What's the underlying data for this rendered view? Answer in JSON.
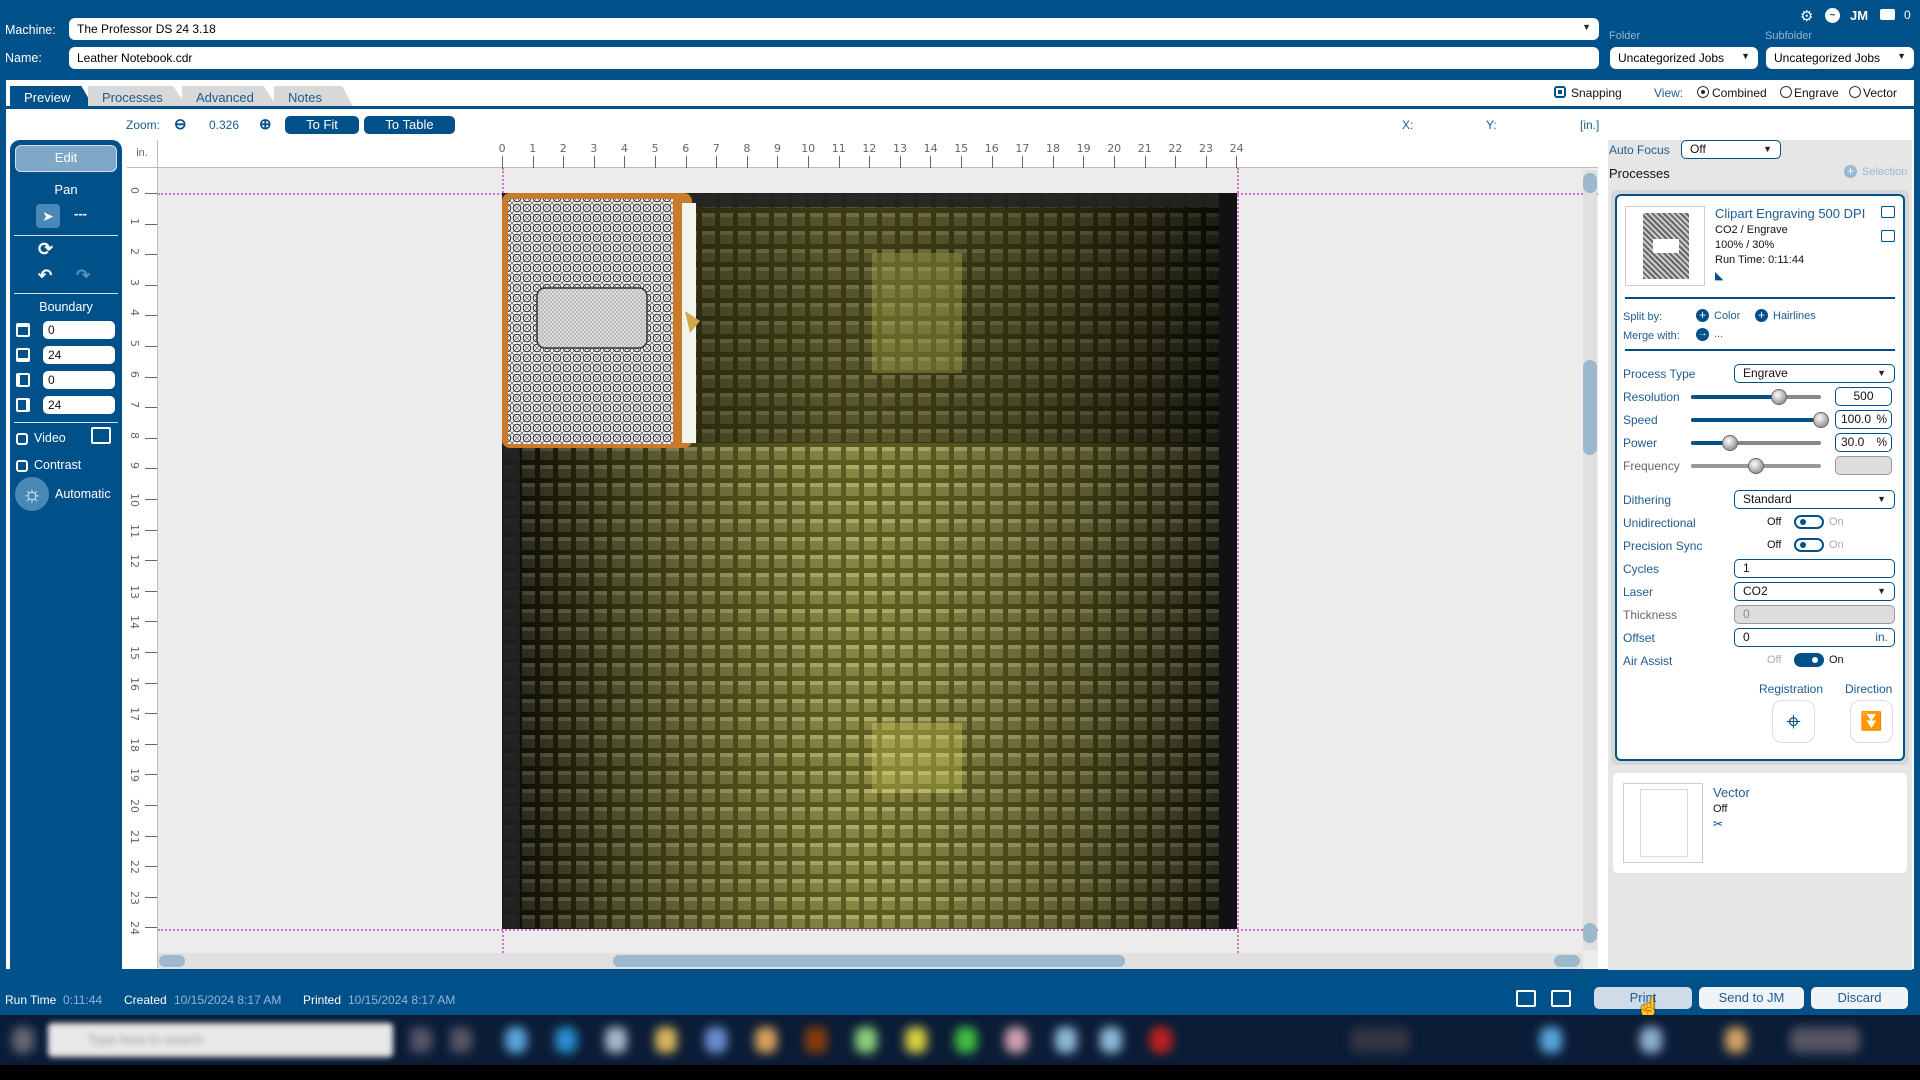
{
  "header": {
    "machine_label": "Machine:",
    "machine_value": "The Professor DS 24 3.18",
    "name_label": "Name:",
    "name_value": "Leather Notebook.cdr",
    "folder_label": "Folder",
    "folder_value": "Uncategorized Jobs",
    "subfolder_label": "Subfolder",
    "subfolder_value": "Uncategorized Jobs",
    "top_icons": [
      "gear-icon",
      "activity-icon",
      "jm-icon",
      "printer-icon"
    ],
    "jm_text": "JM",
    "printer_count": "0"
  },
  "tabs": [
    {
      "label": "Preview",
      "active": true
    },
    {
      "label": "Processes",
      "active": false
    },
    {
      "label": "Advanced",
      "active": false
    },
    {
      "label": "Notes",
      "active": false
    }
  ],
  "view_options": {
    "snapping_label": "Snapping",
    "snapping_checked": true,
    "view_label": "View:",
    "modes": [
      {
        "label": "Combined",
        "selected": true
      },
      {
        "label": "Engrave",
        "selected": false
      },
      {
        "label": "Vector",
        "selected": false
      }
    ]
  },
  "toolbar": {
    "zoom_label": "Zoom:",
    "zoom_value": "0.326",
    "to_fit_label": "To Fit",
    "to_table_label": "To Table",
    "x_label": "X:",
    "y_label": "Y:",
    "unit_label": "[in.]"
  },
  "left_panel": {
    "edit_label": "Edit",
    "pan_label": "Pan",
    "dashes": "---",
    "boundary_label": "Boundary",
    "boundary_values": [
      "0",
      "24",
      "0",
      "24"
    ],
    "video_label": "Video",
    "contrast_label": "Contrast",
    "automatic_label": "Automatic"
  },
  "ruler": {
    "unit": "in.",
    "top_ticks": [
      "0",
      "1",
      "2",
      "3",
      "4",
      "5",
      "6",
      "7",
      "8",
      "9",
      "10",
      "11",
      "12",
      "13",
      "14",
      "15",
      "16",
      "17",
      "18",
      "19",
      "20",
      "21",
      "22",
      "23",
      "24"
    ],
    "left_ticks": [
      "0",
      "1",
      "2",
      "3",
      "4",
      "5",
      "6",
      "7",
      "8",
      "9",
      "10",
      "11",
      "12",
      "13",
      "14",
      "15",
      "16",
      "17",
      "18",
      "19",
      "20",
      "21",
      "22",
      "23",
      "24"
    ]
  },
  "right_panel": {
    "auto_focus_label": "Auto Focus",
    "auto_focus_value": "Off",
    "processes_label": "Processes",
    "selection_label": "Selection",
    "process": {
      "title": "Clipart Engraving 500 DPI",
      "line1": "CO2 / Engrave",
      "line2": "100% / 30%",
      "line3": "Run Time: 0:11:44",
      "split_by_label": "Split by:",
      "split_color": "Color",
      "split_hairlines": "Hairlines",
      "merge_with_label": "Merge with:",
      "merge_value": "...",
      "process_type_label": "Process Type",
      "process_type_value": "Engrave",
      "resolution_label": "Resolution",
      "resolution_value": "500",
      "resolution_fraction": 0.68,
      "speed_label": "Speed",
      "speed_value": "100.0",
      "speed_fraction": 1.0,
      "power_label": "Power",
      "power_value": "30.0",
      "power_fraction": 0.3,
      "percent": "%",
      "frequency_label": "Frequency",
      "frequency_fraction": 0.5,
      "dithering_label": "Dithering",
      "dithering_value": "Standard",
      "unidirectional_label": "Unidirectional",
      "precision_sync_label": "Precision Sync",
      "off_label": "Off",
      "on_label": "On",
      "unidirectional_on": false,
      "precision_sync_on": false,
      "cycles_label": "Cycles",
      "cycles_value": "1",
      "laser_label": "Laser",
      "laser_value": "CO2",
      "thickness_label": "Thickness",
      "thickness_value": "0",
      "offset_label": "Offset",
      "offset_value": "0",
      "offset_unit": "in.",
      "air_assist_label": "Air Assist",
      "air_assist_on": true,
      "registration_label": "Registration",
      "direction_label": "Direction"
    },
    "vector": {
      "title": "Vector",
      "status": "Off"
    }
  },
  "status_bar": {
    "run_time_label": "Run Time",
    "run_time_value": "0:11:44",
    "created_label": "Created",
    "created_value": "10/15/2024 8:17 AM",
    "printed_label": "Printed",
    "printed_value": "10/15/2024 8:17 AM"
  },
  "actions": {
    "print_label": "Print",
    "send_to_jm_label": "Send to JM",
    "discard_label": "Discard"
  },
  "taskbar": {
    "search_placeholder": "Type here to search"
  }
}
